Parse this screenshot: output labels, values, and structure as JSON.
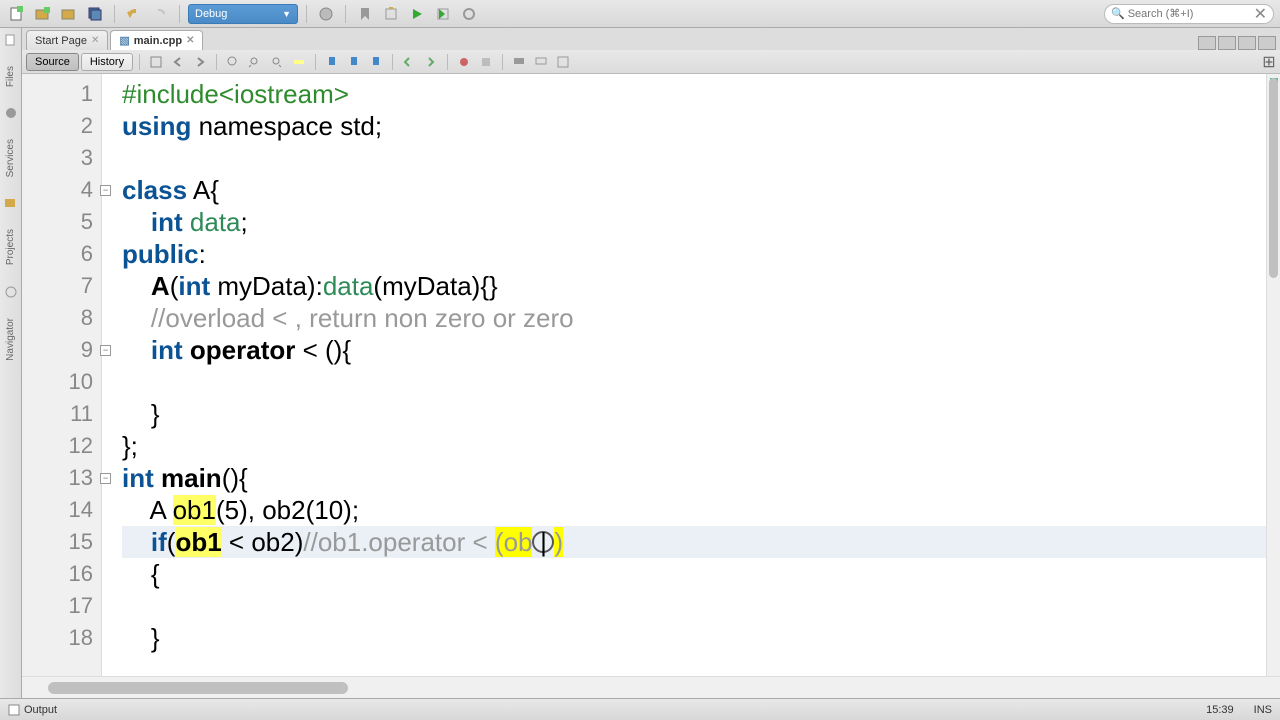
{
  "toolbar": {
    "config": "Debug",
    "search_placeholder": "Search (⌘+I)"
  },
  "tabs": {
    "start": "Start Page",
    "main": "main.cpp"
  },
  "sec": {
    "source": "Source",
    "history": "History"
  },
  "sidebar": {
    "tabs": [
      "Files",
      "Services",
      "Projects",
      "Navigator"
    ]
  },
  "code": {
    "lines": [
      {
        "n": "1"
      },
      {
        "n": "2"
      },
      {
        "n": "3"
      },
      {
        "n": "4"
      },
      {
        "n": "5"
      },
      {
        "n": "6"
      },
      {
        "n": "7"
      },
      {
        "n": "8"
      },
      {
        "n": "9"
      },
      {
        "n": "10"
      },
      {
        "n": "11"
      },
      {
        "n": "12"
      },
      {
        "n": "13"
      },
      {
        "n": "14"
      },
      {
        "n": "15"
      },
      {
        "n": "16"
      },
      {
        "n": "17"
      },
      {
        "n": "18"
      }
    ],
    "l1_a": "#include",
    "l1_b": "<iostream>",
    "l2_a": "using",
    "l2_b": " namespace std;",
    "l4_a": "class",
    "l4_b": " A{",
    "l5_a": "    ",
    "l5_b": "int",
    "l5_c": " ",
    "l5_d": "data",
    "l5_e": ";",
    "l6_a": "public",
    "l6_b": ":",
    "l7_a": "    ",
    "l7_b": "A",
    "l7_c": "(",
    "l7_d": "int",
    "l7_e": " myData):",
    "l7_f": "data",
    "l7_g": "(myData){}",
    "l8_a": "    ",
    "l8_b": "//overload < , return non zero or zero",
    "l9_a": "    ",
    "l9_b": "int",
    "l9_c": " ",
    "l9_d": "operator",
    "l9_e": " < (){",
    "l10": "",
    "l11": "    }",
    "l12": "};",
    "l13_a": "int",
    "l13_b": " ",
    "l13_c": "main",
    "l13_d": "(){",
    "l14_a": "    A ",
    "l14_b": "ob1",
    "l14_c": "(5), ob2(10);",
    "l15_a": "    ",
    "l15_b": "if",
    "l15_c": "(",
    "l15_d": "ob1",
    "l15_e": " < ob2)",
    "l15_f": "//ob1.operator < ",
    "l15_g": "(ob",
    "l15_h": ")",
    "l16": "    {",
    "l17": "",
    "l18": "    }"
  },
  "status": {
    "output": "Output",
    "pos": "15:39",
    "mode": "INS"
  }
}
